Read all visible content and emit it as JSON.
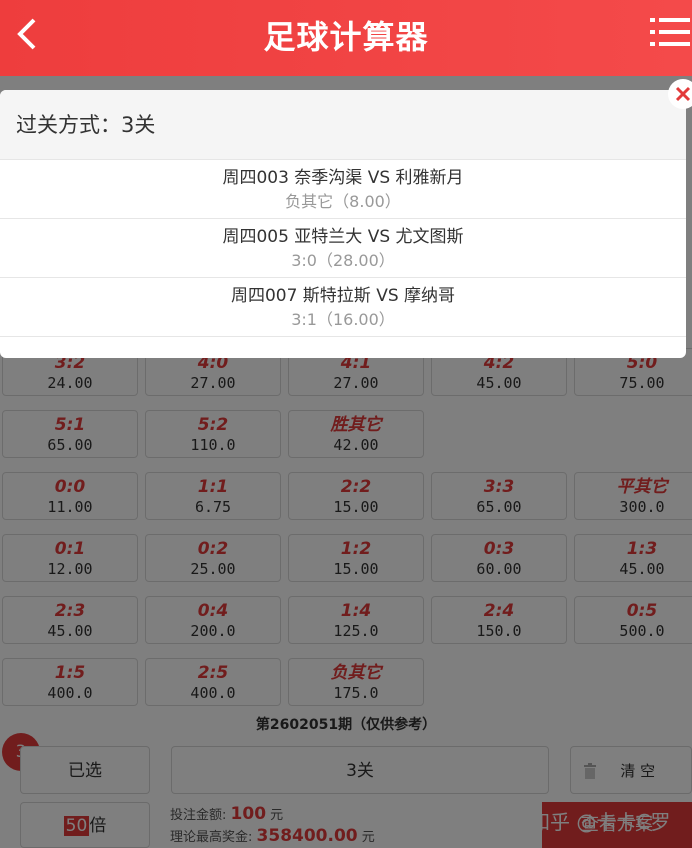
{
  "header": {
    "title": "足球计算器",
    "back_icon": "chevron-left-icon",
    "menu_icon": "list-menu-icon"
  },
  "grid": {
    "rows": [
      [
        {
          "score": "3:2",
          "odds": "24.00"
        },
        {
          "score": "4:0",
          "odds": "27.00"
        },
        {
          "score": "4:1",
          "odds": "27.00"
        },
        {
          "score": "4:2",
          "odds": "45.00"
        },
        {
          "score": "5:0",
          "odds": "75.00"
        }
      ],
      [
        {
          "score": "5:1",
          "odds": "65.00"
        },
        {
          "score": "5:2",
          "odds": "110.0"
        },
        {
          "score": "胜其它",
          "odds": "42.00"
        }
      ],
      [
        {
          "score": "0:0",
          "odds": "11.00"
        },
        {
          "score": "1:1",
          "odds": "6.75"
        },
        {
          "score": "2:2",
          "odds": "15.00"
        },
        {
          "score": "3:3",
          "odds": "65.00"
        },
        {
          "score": "平其它",
          "odds": "300.0"
        }
      ],
      [
        {
          "score": "0:1",
          "odds": "12.00"
        },
        {
          "score": "0:2",
          "odds": "25.00"
        },
        {
          "score": "1:2",
          "odds": "15.00"
        },
        {
          "score": "0:3",
          "odds": "60.00"
        },
        {
          "score": "1:3",
          "odds": "45.00"
        }
      ],
      [
        {
          "score": "2:3",
          "odds": "45.00"
        },
        {
          "score": "0:4",
          "odds": "200.0"
        },
        {
          "score": "1:4",
          "odds": "125.0"
        },
        {
          "score": "2:4",
          "odds": "150.0"
        },
        {
          "score": "0:5",
          "odds": "500.0"
        }
      ],
      [
        {
          "score": "1:5",
          "odds": "400.0"
        },
        {
          "score": "2:5",
          "odds": "400.0"
        },
        {
          "score": "负其它",
          "odds": "175.0"
        }
      ]
    ]
  },
  "period": "第2602051期（仅供参考）",
  "bottom": {
    "selected_count": "3",
    "selected_label": "已选",
    "pass_label": "3关",
    "clear_label": "清 空",
    "clear_icon": "trash-icon",
    "multiplier_num": "50",
    "multiplier_unit": "倍",
    "bet_label": "投注金额:",
    "bet_value": "100",
    "bet_unit": "元",
    "max_label": "理论最高奖金:",
    "max_value": "358400.00",
    "max_unit": "元",
    "view_label": "查看方案",
    "watermark": "知乎 @卡卡C罗"
  },
  "dialog": {
    "title": "过关方式：3关",
    "close_icon": "close-icon",
    "matches": [
      {
        "teams": "周四003 奈季沟渠 VS 利雅新月",
        "pick": "负其它（8.00）"
      },
      {
        "teams": "周四005 亚特兰大 VS 尤文图斯",
        "pick": "3:0（28.00）"
      },
      {
        "teams": "周四007 斯特拉斯 VS 摩纳哥",
        "pick": "3:1（16.00）"
      }
    ]
  }
}
